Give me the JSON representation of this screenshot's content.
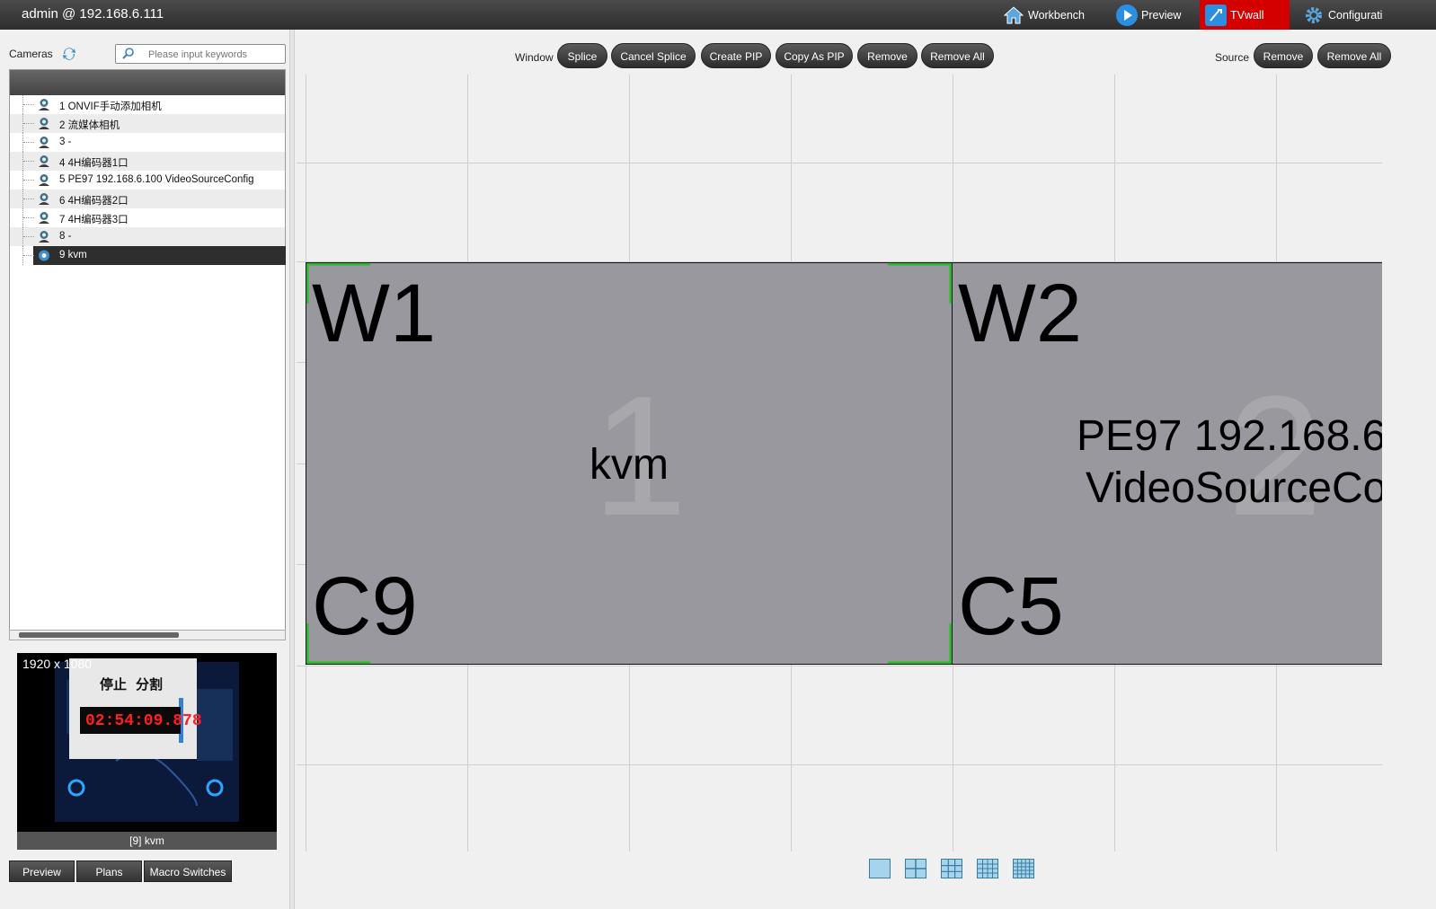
{
  "header": {
    "title": "admin @ 192.168.6.111",
    "nav": [
      {
        "label": "Workbench",
        "icon": "home-icon"
      },
      {
        "label": "Preview",
        "icon": "play-icon"
      },
      {
        "label": "TVwall",
        "icon": "tvwall-icon",
        "active": true
      },
      {
        "label": "Configurati",
        "icon": "gear-icon"
      }
    ]
  },
  "cameras": {
    "label": "Cameras",
    "search_placeholder": "Please input keywords",
    "items": [
      {
        "text": "1  ONVIF手动添加相机"
      },
      {
        "text": "2  流媒体相机"
      },
      {
        "text": "3  -"
      },
      {
        "text": "4  4H编码器1口"
      },
      {
        "text": "5  PE97 192.168.6.100 VideoSourceConfig"
      },
      {
        "text": "6  4H编码器2口"
      },
      {
        "text": "7  4H编码器3口"
      },
      {
        "text": "8  -"
      },
      {
        "text": "9  kvm",
        "selected": true
      }
    ]
  },
  "preview": {
    "resolution": "1920 x 1080",
    "caption": "[9] kvm",
    "btn_stop": "停止",
    "btn_split": "分割",
    "timer": "02:54:09.878"
  },
  "left_tabs": [
    "Preview",
    "Plans",
    "Macro Switches"
  ],
  "toolbar": {
    "window_label": "Window",
    "window_buttons": [
      "Splice",
      "Cancel Splice",
      "Create PIP",
      "Copy As PIP",
      "Remove",
      "Remove All"
    ],
    "source_label": "Source",
    "source_buttons": [
      "Remove",
      "Remove All"
    ]
  },
  "windows": [
    {
      "name": "W1",
      "camera": "C9",
      "index": "1",
      "source_line1": "kvm",
      "source_line2": ""
    },
    {
      "name": "W2",
      "camera": "C5",
      "index": "2",
      "source_line1": "PE97 192.168.6",
      "source_line2": "VideoSourceCo"
    }
  ],
  "colors": {
    "active_tab": "#d40000",
    "window_fill": "#98989e",
    "selection_corner": "#22c022",
    "timer_red": "#ff2020"
  }
}
